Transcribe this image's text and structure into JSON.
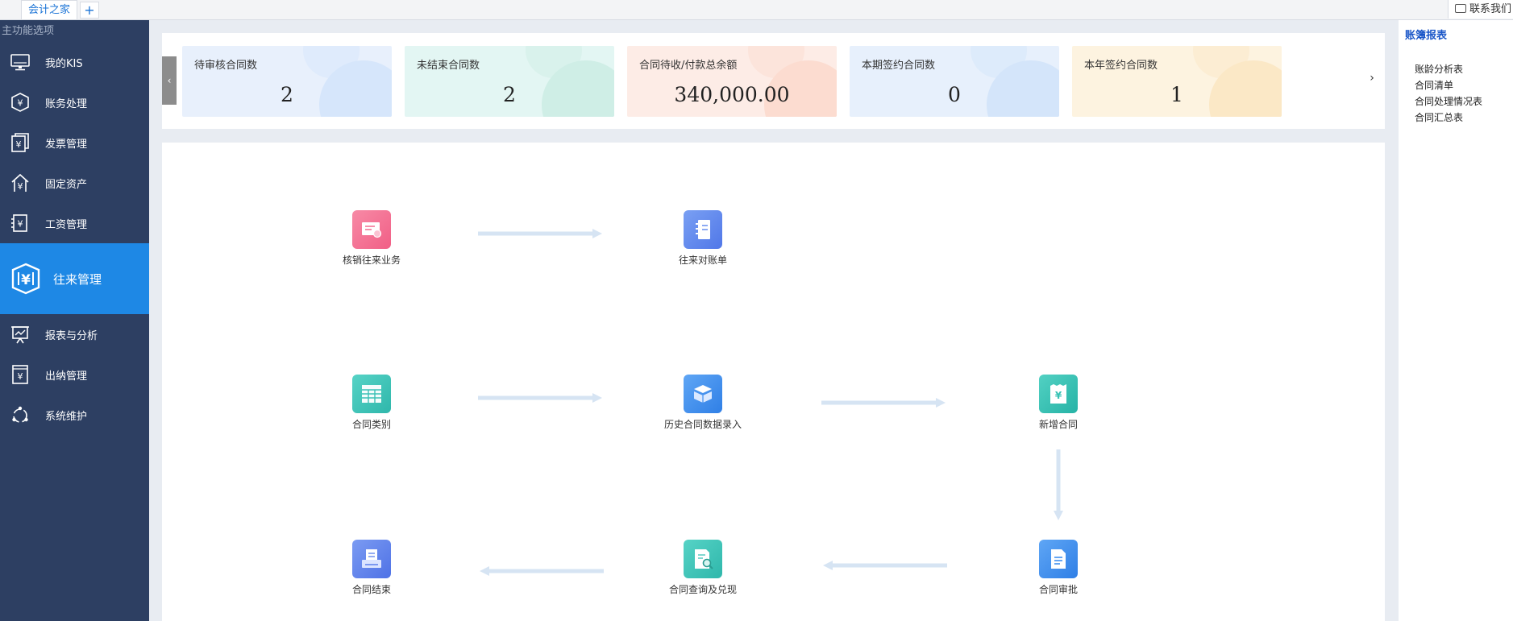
{
  "tabs": {
    "active": "会计之家",
    "add_symbol": "+"
  },
  "contact": "联系我们",
  "sidebar": {
    "header": "主功能选项",
    "items": [
      {
        "label": "我的KIS",
        "icon": "monitor-icon"
      },
      {
        "label": "账务处理",
        "icon": "ledger-icon"
      },
      {
        "label": "发票管理",
        "icon": "invoice-icon"
      },
      {
        "label": "固定资产",
        "icon": "house-yen-icon"
      },
      {
        "label": "工资管理",
        "icon": "payroll-icon"
      },
      {
        "label": "往来管理",
        "icon": "yen-shield-icon",
        "active": true
      },
      {
        "label": "报表与分析",
        "icon": "chart-board-icon"
      },
      {
        "label": "出纳管理",
        "icon": "cashier-icon"
      },
      {
        "label": "系统维护",
        "icon": "maintenance-icon"
      }
    ]
  },
  "stats": {
    "prev": "‹",
    "next": "›",
    "cards": [
      {
        "label": "待审核合同数",
        "value": "2",
        "bg": "#e8f0fc",
        "accent": "#d6e6fb"
      },
      {
        "label": "未结束合同数",
        "value": "2",
        "bg": "#e3f6f3",
        "accent": "#cfeee6"
      },
      {
        "label": "合同待收/付款总余额",
        "value": "340,000.00",
        "bg": "#fdece6",
        "accent": "#fcdcd0"
      },
      {
        "label": "本期签约合同数",
        "value": "0",
        "bg": "#e7f0fc",
        "accent": "#d4e5fa"
      },
      {
        "label": "本年签约合同数",
        "value": "1",
        "bg": "#fdf3e0",
        "accent": "#fbe8c6"
      }
    ]
  },
  "flow": {
    "nodes": [
      {
        "id": "writeoff",
        "label": "核销往来业务",
        "color": "#f36a8f"
      },
      {
        "id": "statement",
        "label": "往来对账单",
        "color": "#5b86ee"
      },
      {
        "id": "category",
        "label": "合同类别",
        "color": "#3cc1b6"
      },
      {
        "id": "history",
        "label": "历史合同数据录入",
        "color": "#3f8ff0"
      },
      {
        "id": "new",
        "label": "新增合同",
        "color": "#36c2b4"
      },
      {
        "id": "end",
        "label": "合同结束",
        "color": "#5b7fea"
      },
      {
        "id": "query",
        "label": "合同查询及兑现",
        "color": "#3cc1b6"
      },
      {
        "id": "approve",
        "label": "合同审批",
        "color": "#3f8ff0"
      }
    ]
  },
  "right_panel": {
    "title": "账簿报表",
    "links": [
      "账龄分析表",
      "合同清单",
      "合同处理情况表",
      "合同汇总表"
    ]
  }
}
